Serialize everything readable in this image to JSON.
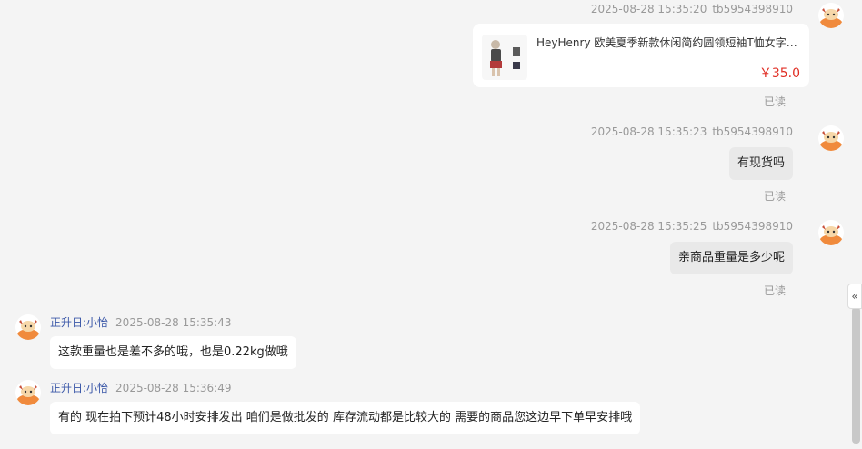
{
  "messages_out": [
    {
      "timestamp": "2025-08-28 15:35:20",
      "sender": "tb5954398910"
    },
    {
      "timestamp": "2025-08-28 15:35:23",
      "sender": "tb5954398910",
      "text": "有现货吗"
    },
    {
      "timestamp": "2025-08-28 15:35:25",
      "sender": "tb5954398910",
      "text": "亲商品重量是多少呢"
    }
  ],
  "product": {
    "title": "HeyHenry 欧美夏季新款休闲简约圆领短袖T恤女字母...",
    "price": "￥35.0"
  },
  "read_label": "已读",
  "messages_in": [
    {
      "agent": "正升日:小怡",
      "timestamp": "2025-08-28 15:35:43",
      "text": "这款重量也是差不多的哦，也是0.22kg做哦"
    },
    {
      "agent": "正升日:小怡",
      "timestamp": "2025-08-28 15:36:49",
      "text": "有的 现在拍下预计48小时安排发出  咱们是做批发的 库存流动都是比较大的 需要的商品您这边早下单早安排哦"
    }
  ],
  "collapse_label": "«",
  "icons": {
    "avatar": "cartoon-avatar-icon",
    "collapse": "double-chevron-left-icon"
  },
  "colors": {
    "background": "#f4f4f4",
    "price": "#e02e24",
    "agent_name": "#3a57a8",
    "avatar_orange": "#f08a3c"
  }
}
